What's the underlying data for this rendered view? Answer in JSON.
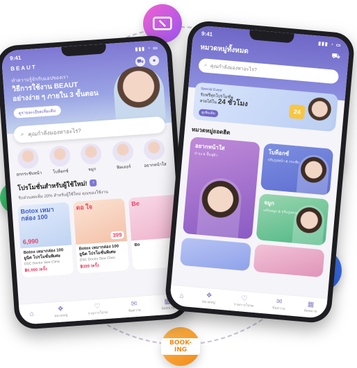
{
  "left_phone": {
    "status_time": "9:41",
    "brand": "BEAUT",
    "hero": {
      "kicker": "ทำความรู้จักกับแอปของเรา",
      "title_line1": "วิธีการใช้งาน BEAUT",
      "title_line2": "อย่างง่าย ๆ ภายใน 3 ขั้นตอน",
      "cta": "ดูรายละเอียดเพิ่มเติม"
    },
    "search_placeholder": "คุณกำลังมองหาอะไร?",
    "categories": [
      {
        "label": "ยกกระชับหน้า"
      },
      {
        "label": "โบท็อกซ์"
      },
      {
        "label": "จมูก"
      },
      {
        "label": "ฟิลเลอร์"
      },
      {
        "label": "อยากหน้าใส"
      }
    ],
    "promo_title": "โปรโมชั่นสำหรับผู้ใช้ใหม่!",
    "promo_sub": "รับส่วนลดเพิ่ม 20% สำหรับผู้ใช้ใหม่ คุณของใช้งาน",
    "cards": [
      {
        "headline": "Botox เหมากล่อง 100",
        "price_tag": "6,990",
        "name": "Botox เหมากล่อง 100 ยูนิต โปรโมชั่นพิเศษ",
        "clinic": "DSC Doctor Sew Clinic",
        "cost": "฿6,990 /ครั้ง"
      },
      {
        "headline": "ดอ ใจ",
        "price_tag": "399",
        "name": "Botox เหมากล่อง 100 ยูนิต โปรโมชั่นพิเศษ",
        "clinic": "DSC Doctor Sew Clinic",
        "cost": "฿399 /ครั้ง"
      },
      {
        "headline": "Be",
        "price_tag": "",
        "name": "Bo",
        "clinic": "",
        "cost": ""
      }
    ],
    "tabs": [
      {
        "icon": "home-icon",
        "label": ""
      },
      {
        "icon": "category-icon",
        "label": "หมวดหมู่"
      },
      {
        "icon": "heart-icon",
        "label": "รายการโปรด"
      },
      {
        "icon": "mail-icon",
        "label": "ข้อความ"
      },
      {
        "icon": "calendar-icon",
        "label": "นัดหมาย"
      }
    ]
  },
  "right_phone": {
    "status_time": "9:41",
    "title": "หมวดหมู่ทั้งหมด",
    "search_placeholder": "คุณกำลังมองหาอะไร?",
    "banner": {
      "event": "Special Event",
      "line1": "รับฟรีทุกโปรโมชั่น",
      "line2_prefix": "สวยได้ใน",
      "line2_bold": "24 ชั่วโมง",
      "button": "ดูเพิ่มเติม",
      "badge": "24"
    },
    "section_title": "หมวดหมู่ยอดฮิต",
    "grid": [
      {
        "title": "อยากหน้าใส",
        "sub": "บำรุง & ฟื้นฟูผิว"
      },
      {
        "title": "โบท็อกซ์",
        "sub": "ปรับรูปหน้า & กระชับ"
      },
      {
        "title": "จมูก",
        "sub": "เสริมจมูก & ปรับรูปทรง"
      },
      {
        "title": "",
        "sub": ""
      },
      {
        "title": "",
        "sub": ""
      }
    ],
    "tabs": [
      {
        "icon": "home-icon",
        "label": ""
      },
      {
        "icon": "category-icon",
        "label": "หมวดหมู่"
      },
      {
        "icon": "heart-icon",
        "label": "รายการโปรด"
      },
      {
        "icon": "mail-icon",
        "label": "ข้อความ"
      },
      {
        "icon": "calendar-icon",
        "label": "นัดหมาย"
      }
    ]
  },
  "bubbles": {
    "booking_text": "BOOK-ING",
    "icons": [
      "coupon-icon",
      "review-icon",
      "brochure-icon",
      "cart-icon",
      "booking-icon"
    ]
  },
  "colors": {
    "primary": "#7f77d3",
    "accent": "#e8456a",
    "coupon": "#c85af0",
    "review": "#2fbd5e",
    "brochure": "#ec3fa8",
    "cart": "#3f76f0",
    "booking": "#f5a030"
  }
}
